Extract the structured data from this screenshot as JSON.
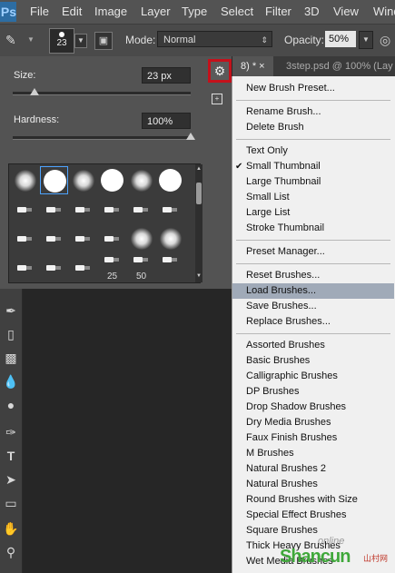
{
  "app": {
    "logo": "Ps",
    "menu": [
      "File",
      "Edit",
      "Image",
      "Layer",
      "Type",
      "Select",
      "Filter",
      "3D",
      "View",
      "Wind"
    ]
  },
  "options": {
    "brush_size_value": "23",
    "mode_label": "Mode:",
    "mode_value": "Normal",
    "opacity_label": "Opacity:",
    "opacity_value": "50%"
  },
  "tabs": {
    "active": "8) * ×",
    "other": "3step.psd @ 100% (Lay"
  },
  "brush_picker": {
    "size_label": "Size:",
    "size_value": "23 px",
    "size_level": 0.12,
    "hardness_label": "Hardness:",
    "hardness_value": "100%",
    "hardness_level": 1.0,
    "number_labels": [
      "25",
      "50"
    ]
  },
  "flyout_menu": {
    "new_brush_preset": "New Brush Preset...",
    "rename_brush": "Rename Brush...",
    "delete_brush": "Delete Brush",
    "text_only": "Text Only",
    "small_thumbnail": "Small Thumbnail",
    "large_thumbnail": "Large Thumbnail",
    "small_list": "Small List",
    "large_list": "Large List",
    "stroke_thumbnail": "Stroke Thumbnail",
    "preset_manager": "Preset Manager...",
    "reset_brushes": "Reset Brushes...",
    "load_brushes": "Load Brushes...",
    "save_brushes": "Save Brushes...",
    "replace_brushes": "Replace Brushes...",
    "libraries": [
      "Assorted Brushes",
      "Basic Brushes",
      "Calligraphic Brushes",
      "DP Brushes",
      "Drop Shadow Brushes",
      "Dry Media Brushes",
      "Faux Finish Brushes",
      "M Brushes",
      "Natural Brushes 2",
      "Natural Brushes",
      "Round Brushes with Size",
      "Special Effect Brushes",
      "Square Brushes",
      "Thick Heavy Brushes",
      "Wet Media Brushes"
    ],
    "checked_item": "small_thumbnail",
    "highlighted_item": "load_brushes"
  },
  "watermark": {
    "online": "online",
    "brand": "Shancun",
    "domain": "山村网"
  },
  "colors": {
    "menubar": "#535353",
    "panel": "#535353",
    "canvas": "#262626",
    "highlight": "#a0aab8",
    "gear_outline": "#c4111b",
    "watermark_green": "#3fa83a"
  }
}
